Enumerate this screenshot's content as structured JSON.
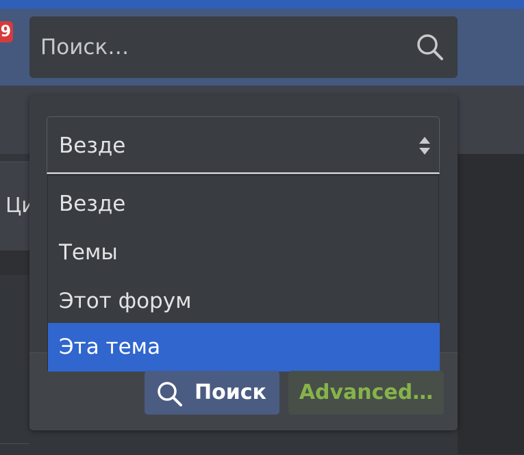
{
  "header": {
    "notification_badge": "9",
    "search": {
      "placeholder": "Поиск…"
    }
  },
  "left_partial": {
    "label": "Ци"
  },
  "search_popup": {
    "scope_select": {
      "selected": "Везде",
      "options": [
        "Везде",
        "Темы",
        "Этот форум",
        "Эта тема"
      ],
      "highlighted": "Эта тема"
    },
    "buttons": {
      "search_label": "Поиск",
      "advanced_label": "Advanced…"
    }
  },
  "colors": {
    "accent_blue": "#3066cd",
    "nav_band": "#45597f",
    "badge_red": "#d63b3b",
    "advanced_text": "#86b34a"
  }
}
